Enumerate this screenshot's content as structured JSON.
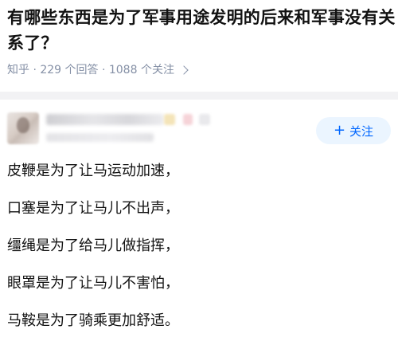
{
  "question": {
    "title": "有哪些东西是为了军事用途发明的后来和军事没有关系了？",
    "meta": "知乎 · 229 个回答 · 1088 个关注"
  },
  "answer": {
    "follow_button": {
      "plus": "+",
      "label": "关注"
    },
    "lines": [
      "皮鞭是为了让马运动加速，",
      "口塞是为了让马儿不出声，",
      "缰绳是为了给马儿做指挥，",
      "眼罩是为了让马儿不害怕，",
      "马鞍是为了骑乘更加舒适。"
    ]
  },
  "colors": {
    "meta_gray": "#8590a6",
    "follow_blue": "#0066ff",
    "follow_bg": "#ebf5ff",
    "divider": "#f2f2f4"
  },
  "icons": {
    "meta_arrow": "chevron-right-icon"
  }
}
